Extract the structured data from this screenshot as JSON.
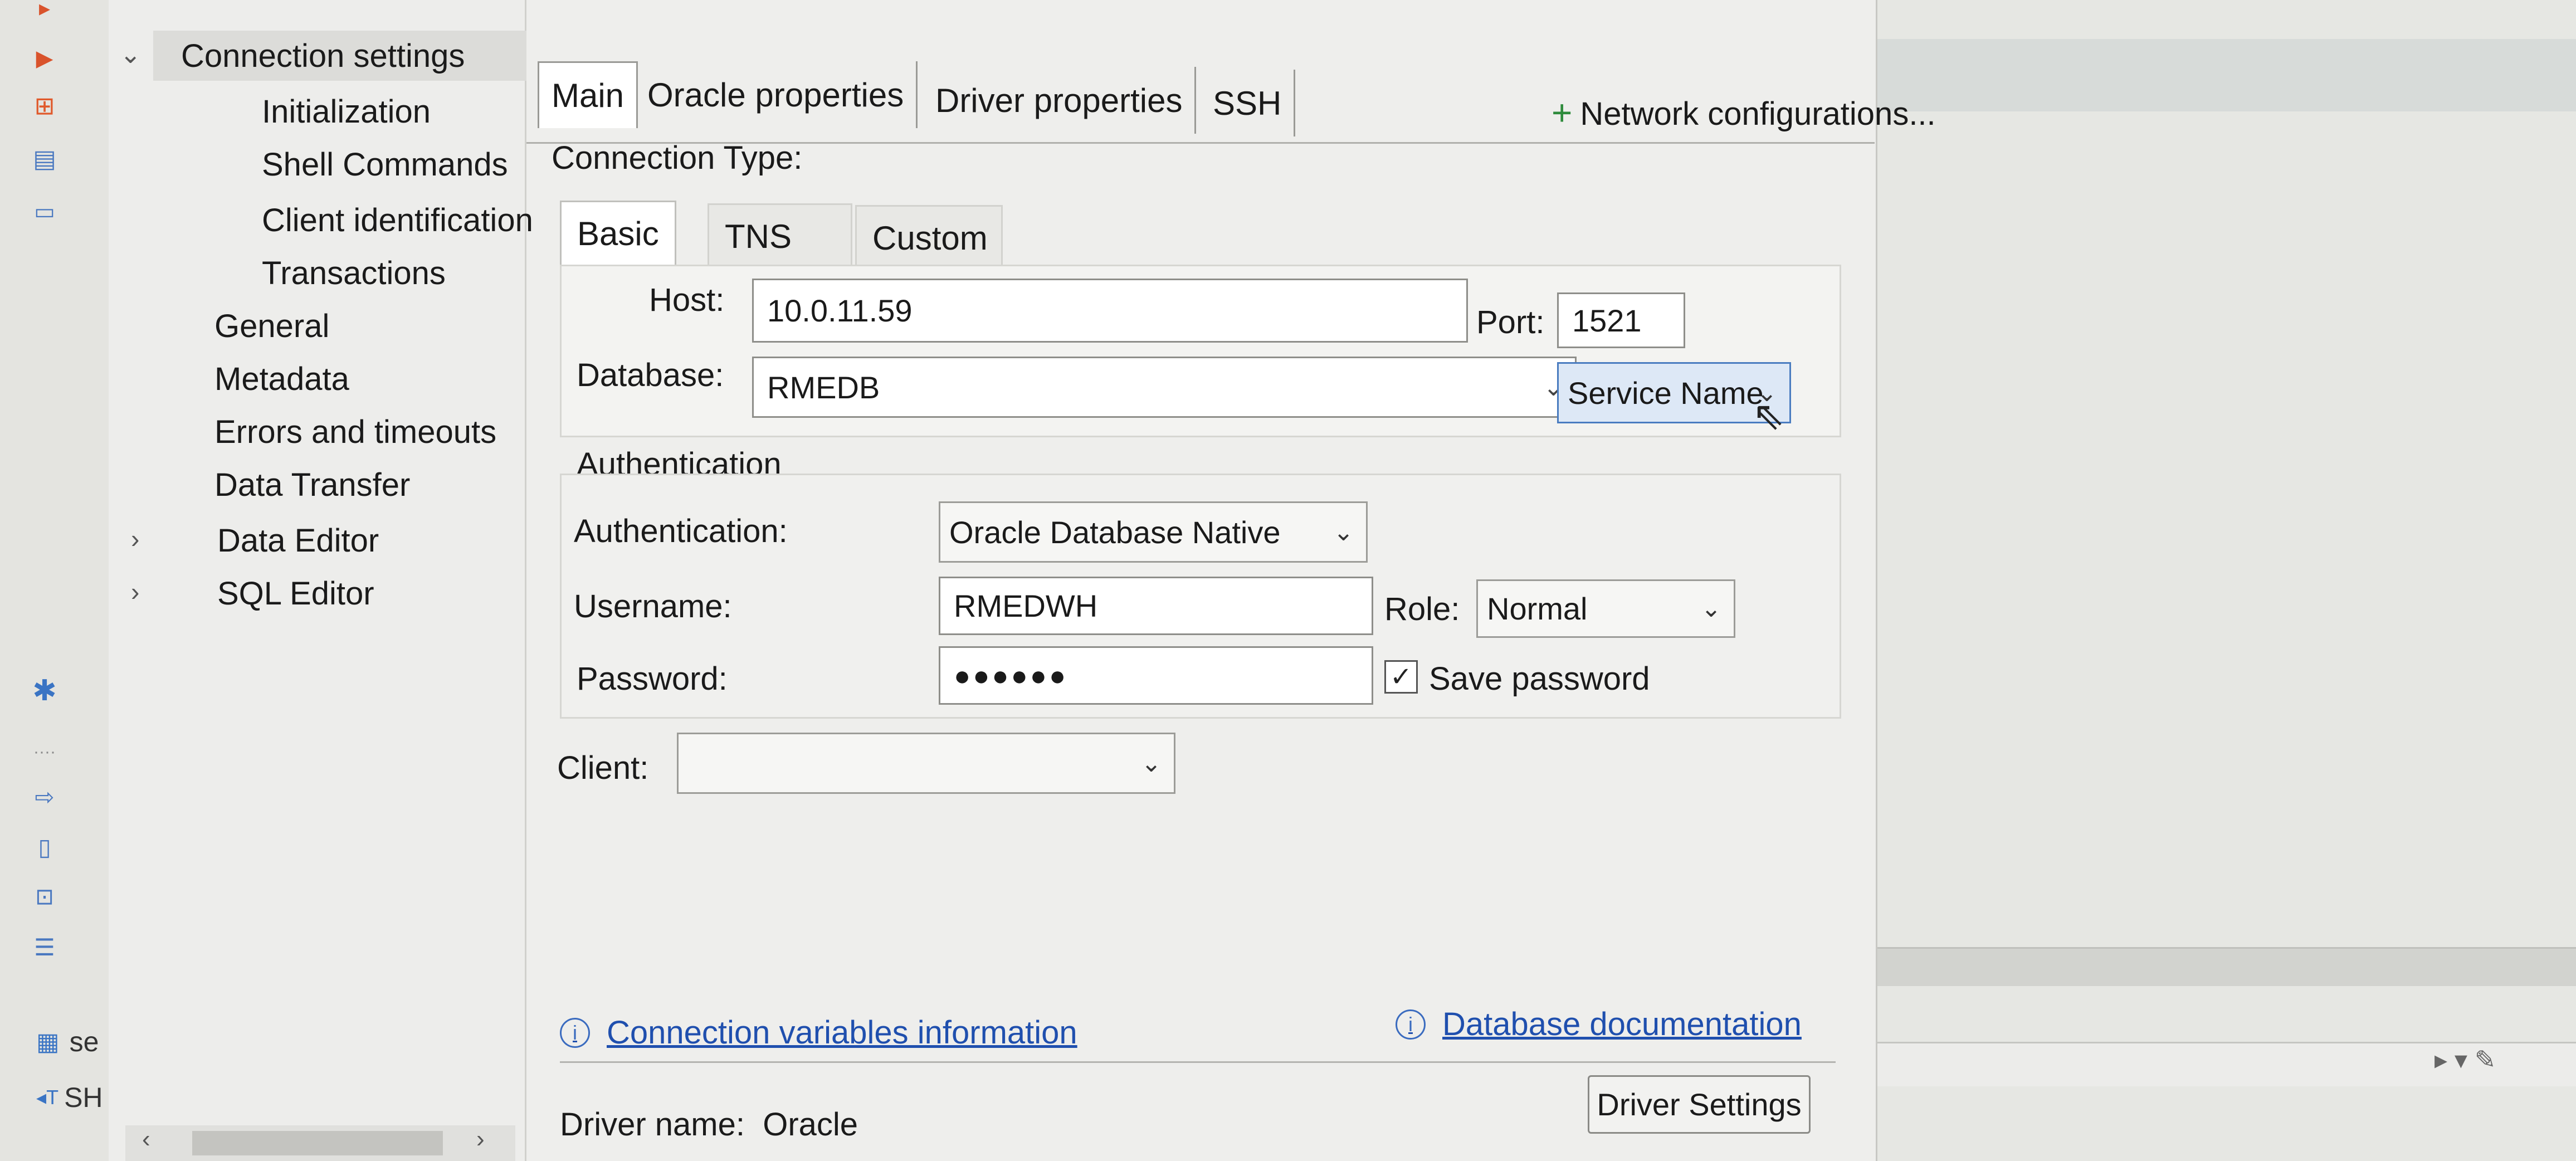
{
  "nav": {
    "items": [
      {
        "label": "Connection settings"
      },
      {
        "label": "Initialization"
      },
      {
        "label": "Shell Commands"
      },
      {
        "label": "Client identification"
      },
      {
        "label": "Transactions"
      },
      {
        "label": "General"
      },
      {
        "label": "Metadata"
      },
      {
        "label": "Errors and timeouts"
      },
      {
        "label": "Data Transfer"
      },
      {
        "label": "Data Editor"
      },
      {
        "label": "SQL Editor"
      }
    ]
  },
  "tabs": [
    "Main",
    "Oracle properties",
    "Driver properties",
    "SSH"
  ],
  "network_config_label": "Network configurations...",
  "connection_type_label": "Connection Type:",
  "subtabs": [
    "Basic",
    "TNS",
    "Custom"
  ],
  "connection": {
    "host_label": "Host:",
    "host_value": "10.0.11.59",
    "port_label": "Port:",
    "port_value": "1521",
    "database_label": "Database:",
    "database_value": "RMEDB",
    "database_type": "Service Name"
  },
  "auth": {
    "group_label": "Authentication",
    "auth_label": "Authentication:",
    "auth_value": "Oracle Database Native",
    "username_label": "Username:",
    "username_value": "RMEDWH",
    "role_label": "Role:",
    "role_value": "Normal",
    "password_label": "Password:",
    "password_value": "●●●●●●",
    "save_password_label": "Save password",
    "save_password_checked": true
  },
  "client_label": "Client:",
  "client_value": "",
  "links": {
    "connection_variables": "Connection variables information",
    "database_documentation": "Database documentation"
  },
  "driver": {
    "name_label": "Driver name:",
    "name_value": "Oracle",
    "settings_button": "Driver Settings"
  },
  "left_strip": {
    "item1": "se",
    "item2": "SH"
  },
  "colors": {
    "accent": "#1f4fae",
    "selected_combo": "#dde8f6"
  }
}
